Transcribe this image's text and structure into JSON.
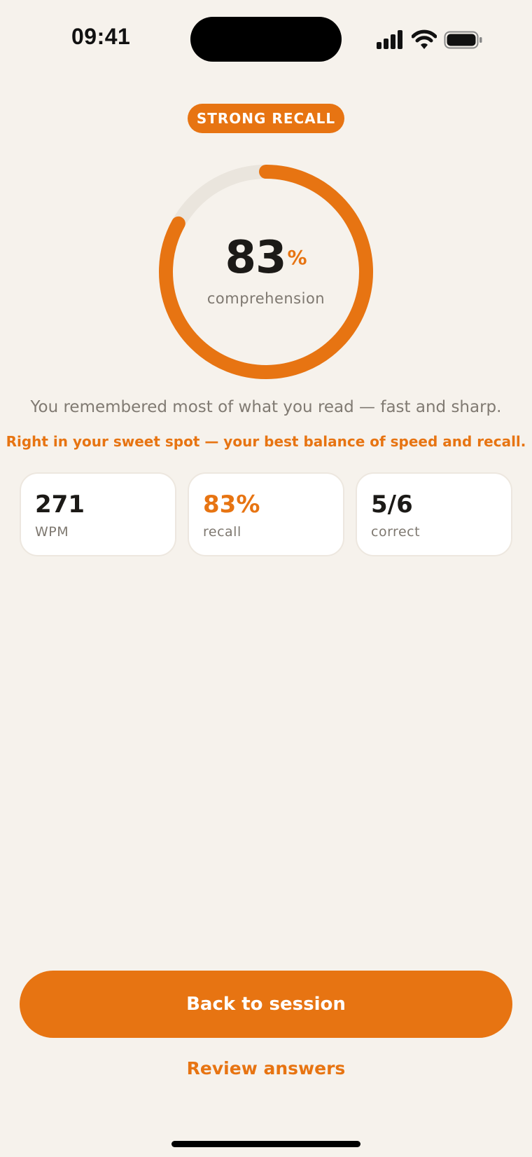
{
  "status_bar": {
    "time": "09:41",
    "icons": [
      "cellular-signal-icon",
      "wifi-icon",
      "battery-icon"
    ]
  },
  "result": {
    "badge": "STRONG RECALL",
    "percent": "83",
    "percent_unit": "%",
    "percent_fraction": 0.83,
    "label": "comprehension",
    "message": "You remembered most of what you read — fast and sharp.",
    "tip": "Right in your sweet spot — your best balance of speed and recall."
  },
  "stats": [
    {
      "value": "271",
      "label": "WPM"
    },
    {
      "value": "83%",
      "label": "recall"
    },
    {
      "value": "5/6",
      "label": "correct"
    }
  ],
  "actions": {
    "primary": "Back to session",
    "secondary": "Review answers"
  },
  "colors": {
    "accent": "#E77412",
    "background": "#F6F2EC",
    "track": "#EAE5DD"
  }
}
